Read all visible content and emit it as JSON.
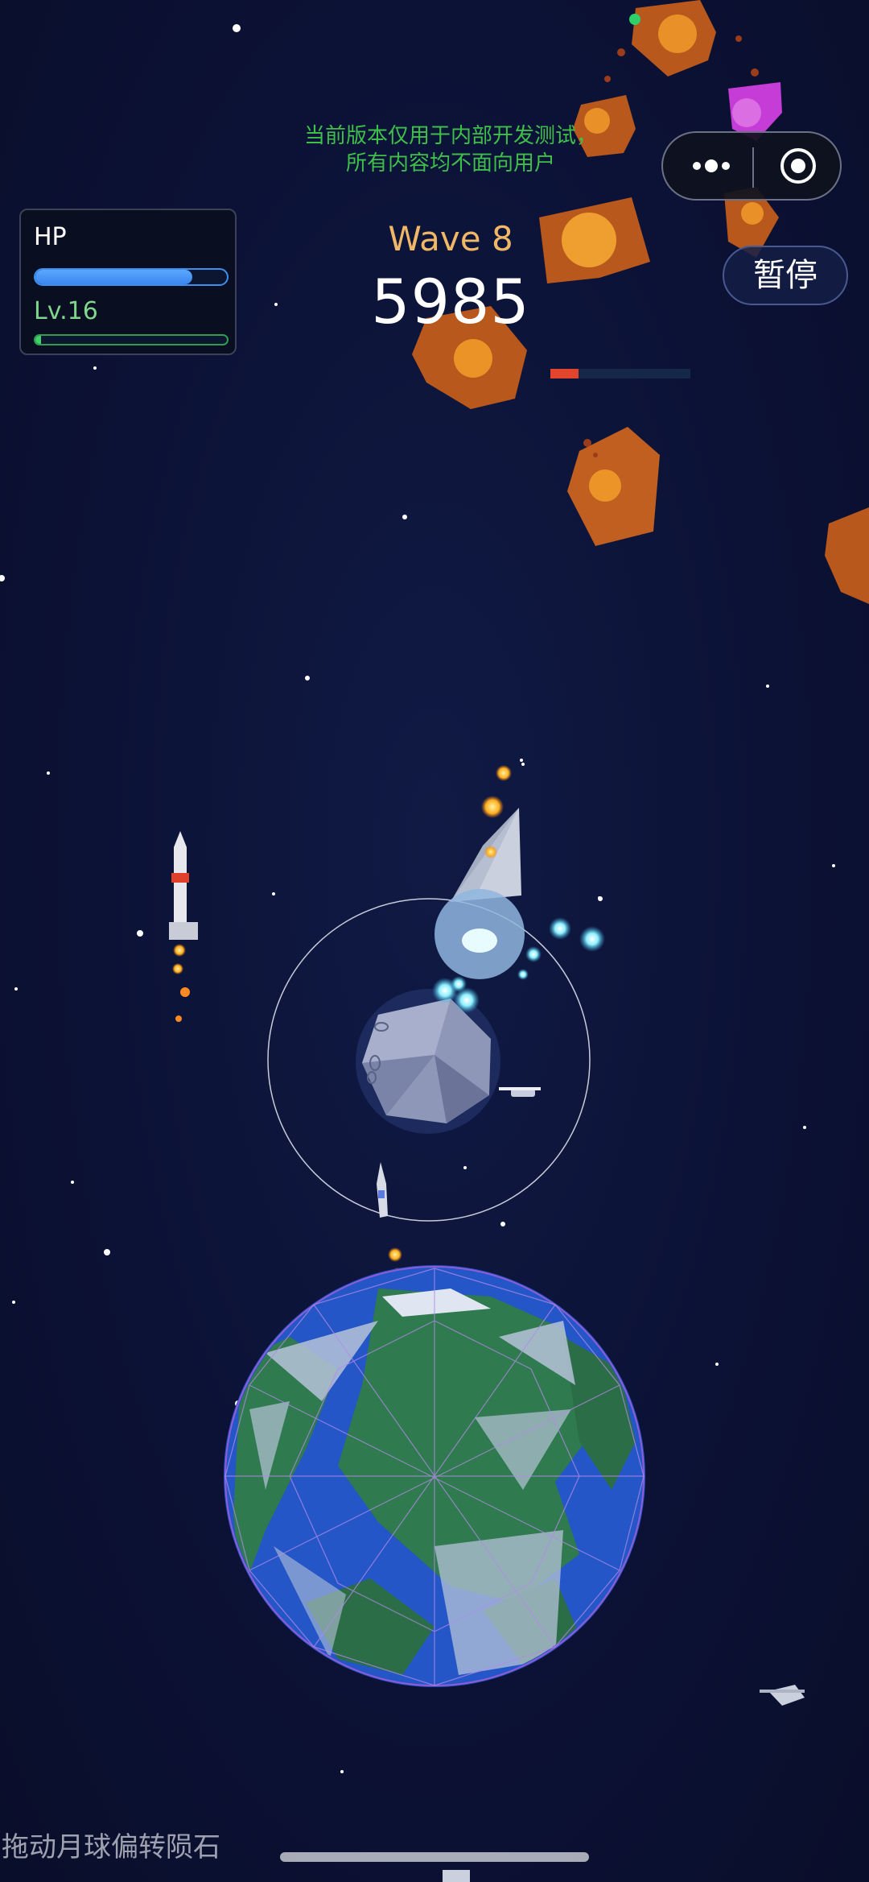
{
  "notice": {
    "line1": "当前版本仅用于内部开发测试，",
    "line2": "所有内容均不面向用户"
  },
  "capsule": {
    "more_icon": "more-dots-icon",
    "close_icon": "target-circle-icon"
  },
  "pause_button": {
    "label": "暂停"
  },
  "hp_panel": {
    "hp_label": "HP",
    "hp_fraction": 0.82,
    "level_label": "Lv.16",
    "xp_fraction": 0.03
  },
  "wave_label": "Wave 8",
  "score": "5985",
  "boss_health_fraction": 0.2,
  "hint": "拖动月球偏转陨石",
  "colors": {
    "notice": "#3fbf4a",
    "wave": "#f0b866",
    "hp": "#3a86ef",
    "xp": "#42d06b",
    "boss": "#e2452e"
  }
}
